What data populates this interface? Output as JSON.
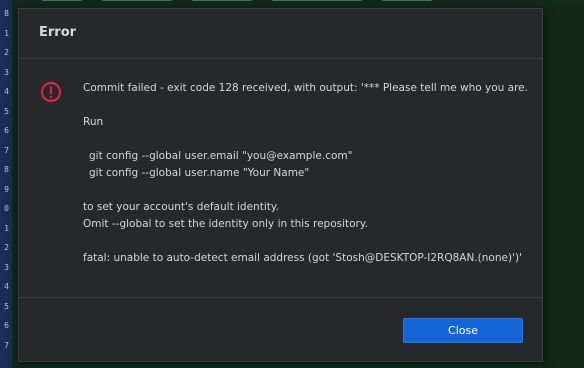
{
  "gutter": {
    "line_numbers": [
      "8",
      "1",
      "2",
      "3",
      "4",
      "5",
      "6",
      "7",
      "8",
      "9",
      "0",
      "1",
      "2",
      "3",
      "4",
      "5",
      "6",
      "7"
    ]
  },
  "dialog": {
    "title": "Error",
    "icon": "error-circle-exclamation-icon",
    "message": {
      "line1": "Commit failed - exit code 128 received, with output: '*** Please tell me who you are.",
      "line2": "Run",
      "line3": "git config --global user.email \"you@example.com\"",
      "line4": "git config --global user.name \"Your Name\"",
      "line5": "to set your account's default identity.",
      "line6": "Omit --global to set the identity only in this repository.",
      "line7": "fatal: unable to auto-detect email address (got 'Stosh@DESKTOP-I2RQ8AN.(none)')'"
    },
    "close_label": "Close"
  },
  "colors": {
    "accent": "#1565d8",
    "error": "#e0243b",
    "dialog_bg": "#26282b",
    "text": "#d4d6d9"
  }
}
